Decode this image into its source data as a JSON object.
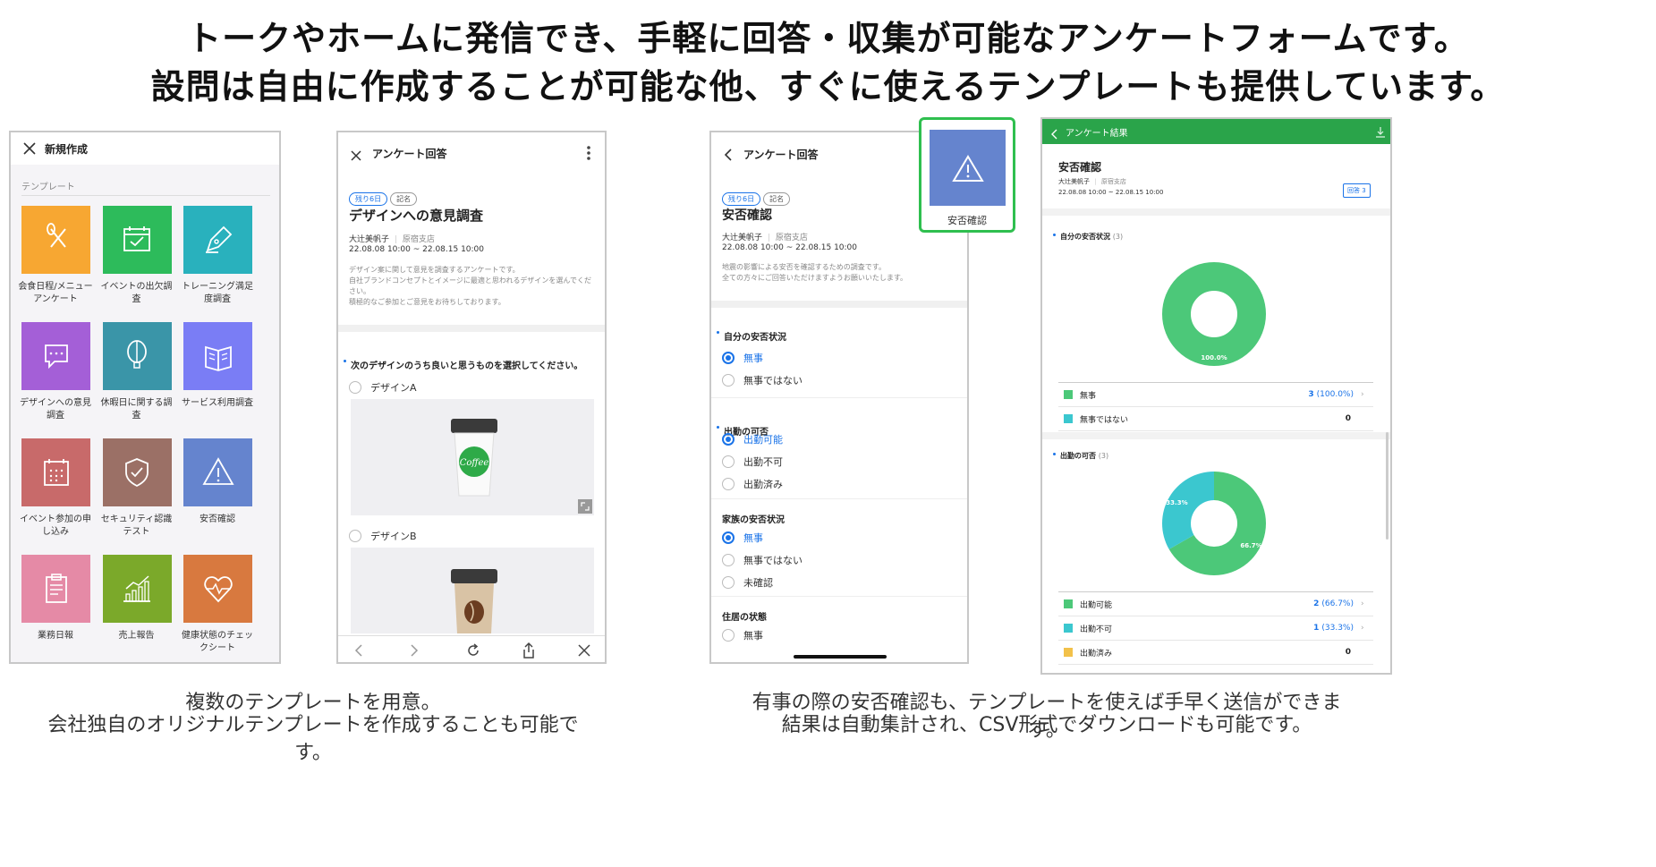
{
  "headline": {
    "line1": "トークやホームに発信でき、手軽に回答・収集が可能なアンケートフォームです。",
    "line2": "設問は自由に作成することが可能な他、すぐに使えるテンプレートも提供しています。"
  },
  "captions": {
    "left_1": "複数のテンプレートを用意。",
    "left_2": "会社独自のオリジナルテンプレートを作成することも可能です。",
    "right_1": "有事の際の安否確認も、テンプレートを使えば手早く送信ができます。",
    "right_2": "結果は自動集計され、CSV形式でダウンロードも可能です。"
  },
  "new_screen": {
    "title": "新規作成",
    "section": "テンプレート",
    "templates": [
      {
        "label": "会食日程/メニュー\nアンケート",
        "color": "#f7a732",
        "icon": "utensils-icon"
      },
      {
        "label": "イベントの出欠調\n査",
        "color": "#2dbb5b",
        "icon": "calendar-check-icon"
      },
      {
        "label": "トレーニング満足\n度調査",
        "color": "#29b1bd",
        "icon": "pen-nib-icon"
      },
      {
        "label": "デザインへの意見\n調査",
        "color": "#a45fd7",
        "icon": "chat-bubble-icon"
      },
      {
        "label": "休暇日に関する調\n査",
        "color": "#3a95a8",
        "icon": "balloon-icon"
      },
      {
        "label": "サービス利用調査",
        "color": "#7a7df5",
        "icon": "book-icon"
      },
      {
        "label": "イベント参加の申\nし込み",
        "color": "#c86a6a",
        "icon": "calendar-grid-icon"
      },
      {
        "label": "セキュリティ認識\nテスト",
        "color": "#9b7066",
        "icon": "shield-check-icon"
      },
      {
        "label": "安否確認",
        "color": "#6584ce",
        "icon": "warning-triangle-icon"
      },
      {
        "label": "業務日報",
        "color": "#e58aa6",
        "icon": "clipboard-icon"
      },
      {
        "label": "売上報告",
        "color": "#7ba92a",
        "icon": "bar-chart-icon"
      },
      {
        "label": "健康状態のチェッ\nクシート",
        "color": "#d8793f",
        "icon": "heart-pulse-icon"
      }
    ]
  },
  "design_survey": {
    "header": "アンケート回答",
    "badge_remaining": "残り6日",
    "badge_named": "記名",
    "title": "デザインへの意見調査",
    "author": "大辻美帆子",
    "office": "原宿支店",
    "period": "22.08.08 10:00 ~ 22.08.15 10:00",
    "description": "デザイン案に関して意見を調査するアンケートです。\n自社ブランドコンセプトとイメージに最適と思われるデザインを選んでください。\n積極的なご参加とご意見をお待ちしております。",
    "question": "次のデザインのうち良いと思うものを選択してください。",
    "option_a": "デザインA",
    "option_b": "デザインB",
    "cup_a_text": "Coffee"
  },
  "safety_survey": {
    "header": "アンケート回答",
    "badge_remaining": "残り6日",
    "badge_named": "記名",
    "title": "安否確認",
    "author": "大辻美帆子",
    "office": "原宿支店",
    "period": "22.08.08 10:00 ~ 22.08.15 10:00",
    "description": "地震の影響による安否を確認するための調査です。\n全ての方々にご回答いただけますようお願いいたします。",
    "q1": {
      "title": "自分の安否状況",
      "options": [
        "無事",
        "無事ではない"
      ],
      "selected": 0
    },
    "q2": {
      "title": "出勤の可否",
      "options": [
        "出勤可能",
        "出勤不可",
        "出勤済み"
      ],
      "selected": 0
    },
    "q3": {
      "title": "家族の安否状況",
      "options": [
        "無事",
        "無事ではない",
        "未確認"
      ],
      "selected": 0
    },
    "q4": {
      "title": "住居の状態",
      "options": [
        "無事"
      ],
      "selected": -1
    },
    "popout_label": "安否確認"
  },
  "results": {
    "header": "アンケート結果",
    "title": "安否確認",
    "author": "大辻美帆子",
    "office": "原宿支店",
    "period": "22.08.08 10:00 ~ 22.08.15 10:00",
    "answer_button": "回答 3",
    "q1_title": "自分の安否状況",
    "q1_count": "(3)",
    "q2_title": "出勤の可否",
    "q2_count": "(3)",
    "q1_rows": [
      {
        "name": "無事",
        "value": "3",
        "pct": "(100.0%)",
        "color": "#4cc879"
      },
      {
        "name": "無事ではない",
        "value": "0",
        "pct": "",
        "color": "#3bc7cf"
      }
    ],
    "q2_rows": [
      {
        "name": "出勤可能",
        "value": "2",
        "pct": "(66.7%)",
        "color": "#4cc879"
      },
      {
        "name": "出勤不可",
        "value": "1",
        "pct": "(33.3%)",
        "color": "#3bc7cf"
      },
      {
        "name": "出勤済み",
        "value": "0",
        "pct": "",
        "color": "#f2c14a"
      }
    ]
  },
  "chart_data": [
    {
      "type": "pie",
      "title": "自分の安否状況",
      "categories": [
        "無事",
        "無事ではない"
      ],
      "values": [
        100.0,
        0
      ],
      "labels": [
        "100.0%"
      ],
      "colors": [
        "#4cc879",
        "#3bc7cf"
      ]
    },
    {
      "type": "pie",
      "title": "出勤の可否",
      "categories": [
        "出勤可能",
        "出勤不可",
        "出勤済み"
      ],
      "values": [
        66.7,
        33.3,
        0
      ],
      "labels": [
        "66.7%",
        "33.3%"
      ],
      "colors": [
        "#4cc879",
        "#3bc7cf",
        "#f2c14a"
      ]
    }
  ]
}
